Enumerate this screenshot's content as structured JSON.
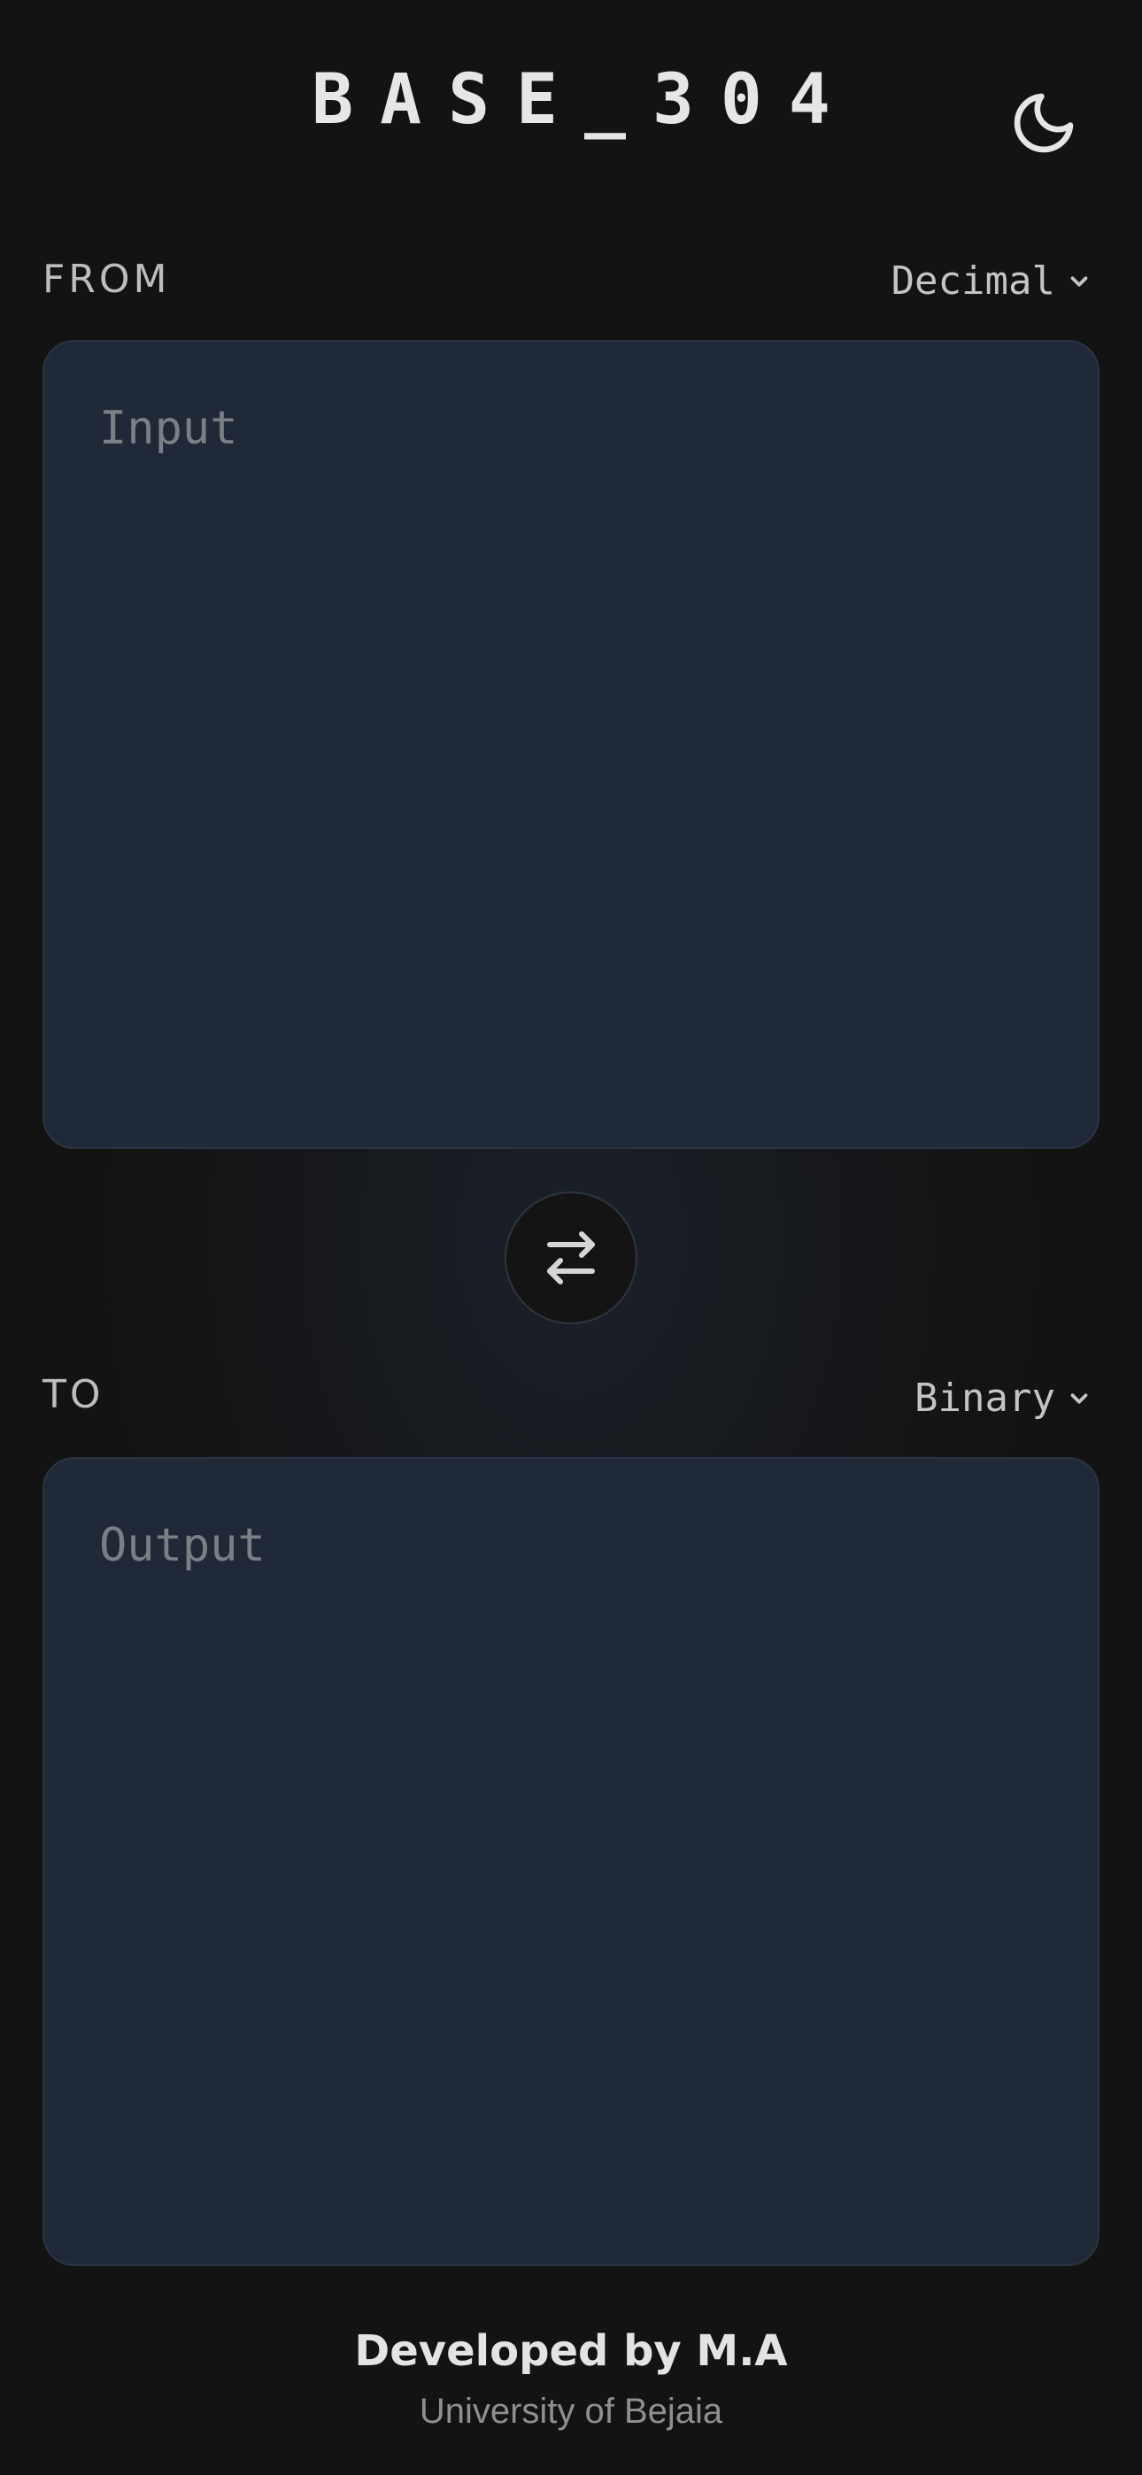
{
  "app": {
    "title": "BASE_304"
  },
  "theme_toggle": {
    "icon": "moon-icon"
  },
  "from": {
    "label": "FROM",
    "selected_base": "Decimal",
    "input_value": "",
    "input_placeholder": "Input"
  },
  "swap": {
    "icon": "swap-arrows-icon"
  },
  "to": {
    "label": "TO",
    "selected_base": "Binary",
    "output_value": "",
    "output_placeholder": "Output"
  },
  "footer": {
    "developer": "Developed by M.A",
    "institution": "University of Bejaia"
  },
  "colors": {
    "background": "#131313",
    "panel": "#202938",
    "text": "#e6e6e6",
    "muted": "#7b7f86"
  }
}
